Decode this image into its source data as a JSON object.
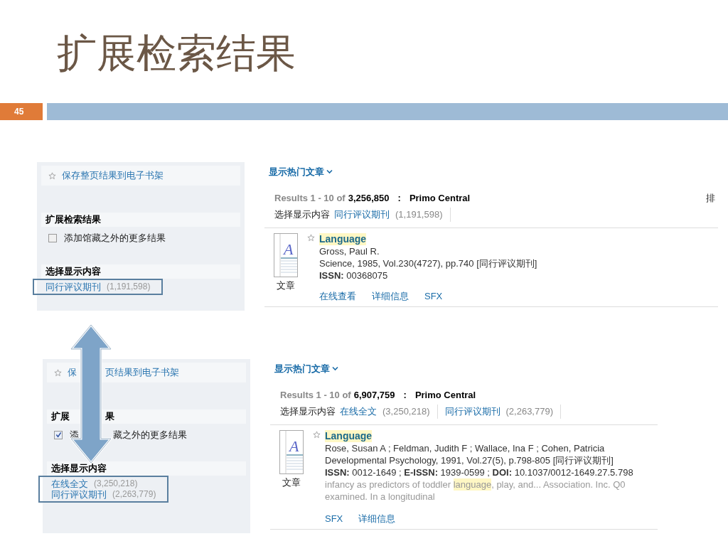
{
  "slide": {
    "title": "扩展检索结果",
    "page_number": "45"
  },
  "screenshots": [
    {
      "sidebar": {
        "save_link": [
          "保存整页结果到电子书架"
        ],
        "expand_heading": [
          "扩展检索结果"
        ],
        "expand_option": {
          "parts": [
            "添加馆藏之外的更多结果"
          ],
          "checked": false
        },
        "content_heading": "选择显示内容",
        "facets": [
          {
            "label": "同行评议期刊",
            "count": "(1,191,598)"
          }
        ]
      },
      "results": {
        "hot_link": "显示热门文章",
        "range": "Results 1 - 10 of",
        "total": "3,256,850",
        "separator": ":",
        "source": "Primo Central",
        "sort_cut": "排",
        "filter_label": "选择显示内容",
        "filters": [
          {
            "label": "同行评议期刊",
            "count": "(1,191,598)"
          }
        ],
        "record": {
          "icon_letter": "A",
          "type_label": "文章",
          "title": "Language",
          "lines": [
            "Gross, Paul R.",
            "Science, 1985, Vol.230(4727), pp.740 [同行评议期刊]",
            "**ISSN:** 00368075"
          ],
          "links": [
            "在线查看",
            "详细信息",
            "SFX"
          ]
        }
      }
    },
    {
      "sidebar": {
        "save_link": [
          "保",
          "页结果到电子书架"
        ],
        "expand_heading": [
          "扩展",
          "果"
        ],
        "expand_option": {
          "parts": [
            "添",
            "藏之外的更多结果"
          ],
          "checked": true
        },
        "content_heading": "选择显示内容",
        "facets": [
          {
            "label": "在线全文",
            "count": "(3,250,218)"
          },
          {
            "label": "同行评议期刊",
            "count": "(2,263,779)"
          }
        ]
      },
      "results": {
        "hot_link": "显示热门文章",
        "range": "Results 1 - 10 of",
        "total": "6,907,759",
        "separator": ":",
        "source": "Primo Central",
        "filter_label": "选择显示内容",
        "filters": [
          {
            "label": "在线全文",
            "count": "(3,250,218)"
          },
          {
            "label": "同行评议期刊",
            "count": "(2,263,779)"
          }
        ],
        "record": {
          "icon_letter": "A",
          "type_label": "文章",
          "title": "Language",
          "lines": [
            "Rose, Susan A ; Feldman, Judith F ; Wallace, Ina F ; Cohen, Patricia",
            "Developmental Psychology, 1991, Vol.27(5), p.798-805 [同行评议期刊]",
            "**ISSN:** 0012-1649 ; **E-ISSN:** 1939-0599 ; **DOI:** 10.1037/0012-1649.27.5.798"
          ],
          "snippet": [
            [
              {
                "text": "infancy as predictors of toddler ",
                "highlighted": false
              },
              {
                "text": "language",
                "highlighted": true
              },
              {
                "text": ", play, and... Association. Inc. Q0",
                "highlighted": false
              }
            ],
            [
              {
                "text": "examined. In a longitudinal",
                "highlighted": false
              }
            ]
          ],
          "links": [
            "SFX",
            "详细信息"
          ]
        }
      }
    }
  ]
}
